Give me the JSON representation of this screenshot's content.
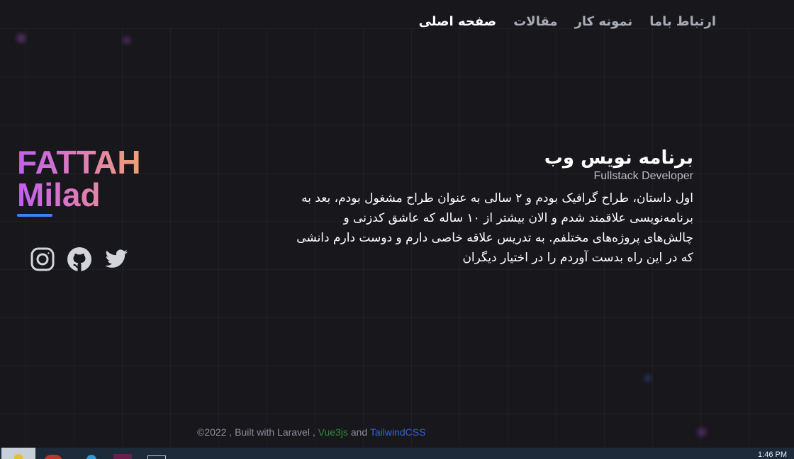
{
  "nav": {
    "items": [
      {
        "label": "صفحه اصلی",
        "active": true
      },
      {
        "label": "مقالات",
        "active": false
      },
      {
        "label": "نمونه کار",
        "active": false
      },
      {
        "label": "ارتباط باما",
        "active": false
      }
    ]
  },
  "brand": {
    "line1": "FATTAH",
    "line2": "Milad"
  },
  "socials": [
    "instagram-icon",
    "github-icon",
    "twitter-icon"
  ],
  "hero": {
    "title": "برنامه نویس وب",
    "subtitle": "Fullstack Developer",
    "bio": "اول داستان، طراح گرافیک بودم و ۲ سالی به عنوان طراح مشغول بودم، بعد به برنامه‌نویسی علاقمند شدم و الان بیشتر از ۱۰ ساله که عاشق کدزنی و چالش‌های پروژه‌های مختلفم. به تدریس علاقه خاصی دارم و دوست دارم دانشی که در این راه بدست آوردم را در اختیار دیگران"
  },
  "footer": {
    "prefix": "©2022 , Built with Laravel ,",
    "vue": "Vue3js",
    "and": "and",
    "tailwind": "TailwindCSS"
  },
  "taskbar": {
    "clock": "1:46 PM"
  },
  "colors": {
    "background": "#17171c",
    "accent_blue": "#3b82f6",
    "gradient_start": "#c15ff0",
    "gradient_end": "#f0a070"
  }
}
